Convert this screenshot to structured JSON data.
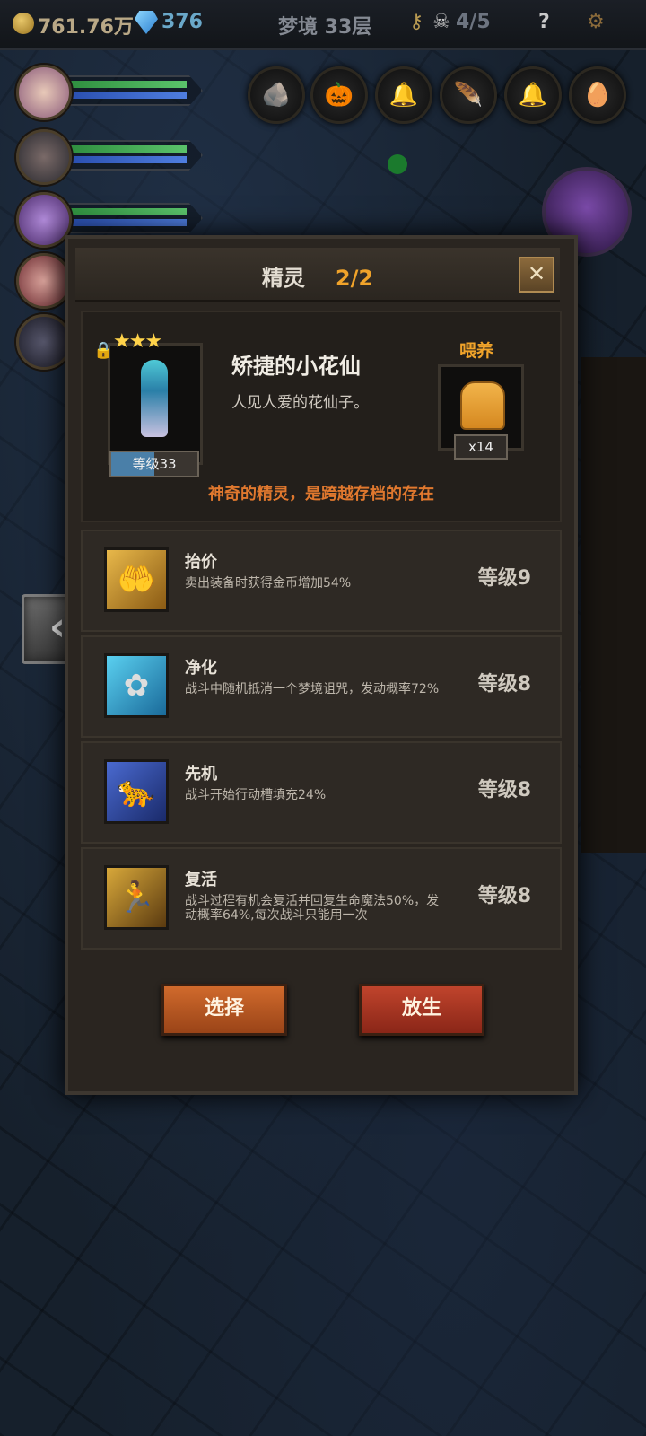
{
  "topbar": {
    "gold": "761.76万",
    "gems": "376",
    "floor": "梦境 33层",
    "skull_count": "4/5"
  },
  "panel": {
    "title": "精灵",
    "count": "2/2"
  },
  "pet": {
    "stars": "★★★",
    "level": "等级33",
    "name": "矫捷的小花仙",
    "description": "人见人爱的花仙子。",
    "feed_label": "喂养",
    "feed_count": "x14",
    "flavor": "神奇的精灵，是跨越存档的存在"
  },
  "skills": [
    {
      "name": "抬价",
      "desc": "卖出装备时获得金币增加54%",
      "level": "等级9"
    },
    {
      "name": "净化",
      "desc": "战斗中随机抵消一个梦境诅咒，发动概率72%",
      "level": "等级8"
    },
    {
      "name": "先机",
      "desc": "战斗开始行动槽填充24%",
      "level": "等级8"
    },
    {
      "name": "复活",
      "desc": "战斗过程有机会复活并回复生命魔法50%，发动概率64%,每次战斗只能用一次",
      "level": "等级8"
    }
  ],
  "buttons": {
    "select": "选择",
    "release": "放生"
  },
  "icons": {
    "close": "close-icon",
    "back": "chevron-left-icon",
    "feed_item": "bread-icon",
    "skill_0": "hand-icon",
    "skill_1": "flower-icon",
    "skill_2": "leopard-icon",
    "skill_3": "revive-icon"
  },
  "colors": {
    "accent_orange": "#f0a32a",
    "flavor_text": "#e0782e",
    "select_button": "#d06a2c",
    "release_button": "#c0442c"
  }
}
